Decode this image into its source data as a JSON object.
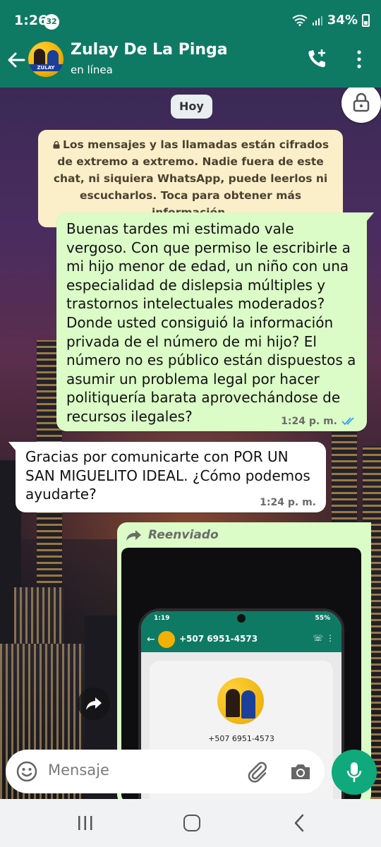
{
  "status_bar": {
    "time": "1:26",
    "notification_count": "32",
    "battery": "34%"
  },
  "header": {
    "contact_name": "Zulay De La Pinga",
    "status": "en línea",
    "avatar_text": "ZULAY"
  },
  "chat": {
    "day_chip": "Hoy",
    "encryption_notice": "Los mensajes y las llamadas están cifrados de extremo a extremo. Nadie fuera de este chat, ni siquiera WhatsApp, puede leerlos ni escucharlos. Toca para obtener más información.",
    "messages": [
      {
        "direction": "outgoing",
        "text": "Buenas tardes mi estimado vale vergoso. Con que permiso le escribirle a mi hijo menor de edad, un niño con una especialidad de dislepsia múltiples y trastornos intelectuales moderados? Donde usted consiguió la información privada de el número de mi hijo? El número no es público están dispuestos a asumir un problema legal por hacer politiquería barata aprovechándose de recursos ilegales?",
        "time": "1:24 p. m.",
        "status": "read"
      },
      {
        "direction": "incoming",
        "text": "Gracias por comunicarte con POR UN SAN MIGUELITO IDEAL. ¿Cómo podemos ayudarte?",
        "time": "1:24 p. m."
      }
    ],
    "forwarded": {
      "label": "Reenviado",
      "image": {
        "inner_time": "1:19",
        "inner_battery": "55%",
        "inner_header_number": "+507 6951-4573",
        "inner_card_number": "+507 6951-4573"
      }
    }
  },
  "input_bar": {
    "placeholder": "Mensaje"
  },
  "colors": {
    "header": "#0f7a64",
    "outgoing_bubble": "#dbfbc7",
    "incoming_bubble": "#ffffff",
    "notice": "#fbefc9",
    "mic_button": "#0fa97c",
    "read_ticks": "#3aa0e8"
  },
  "icons": [
    "back-arrow-icon",
    "call-add-icon",
    "more-vert-icon",
    "lock-icon",
    "forward-icon",
    "share-icon",
    "emoji-icon",
    "paperclip-icon",
    "camera-icon",
    "mic-icon",
    "nav-recents-icon",
    "nav-home-icon",
    "nav-back-icon"
  ]
}
